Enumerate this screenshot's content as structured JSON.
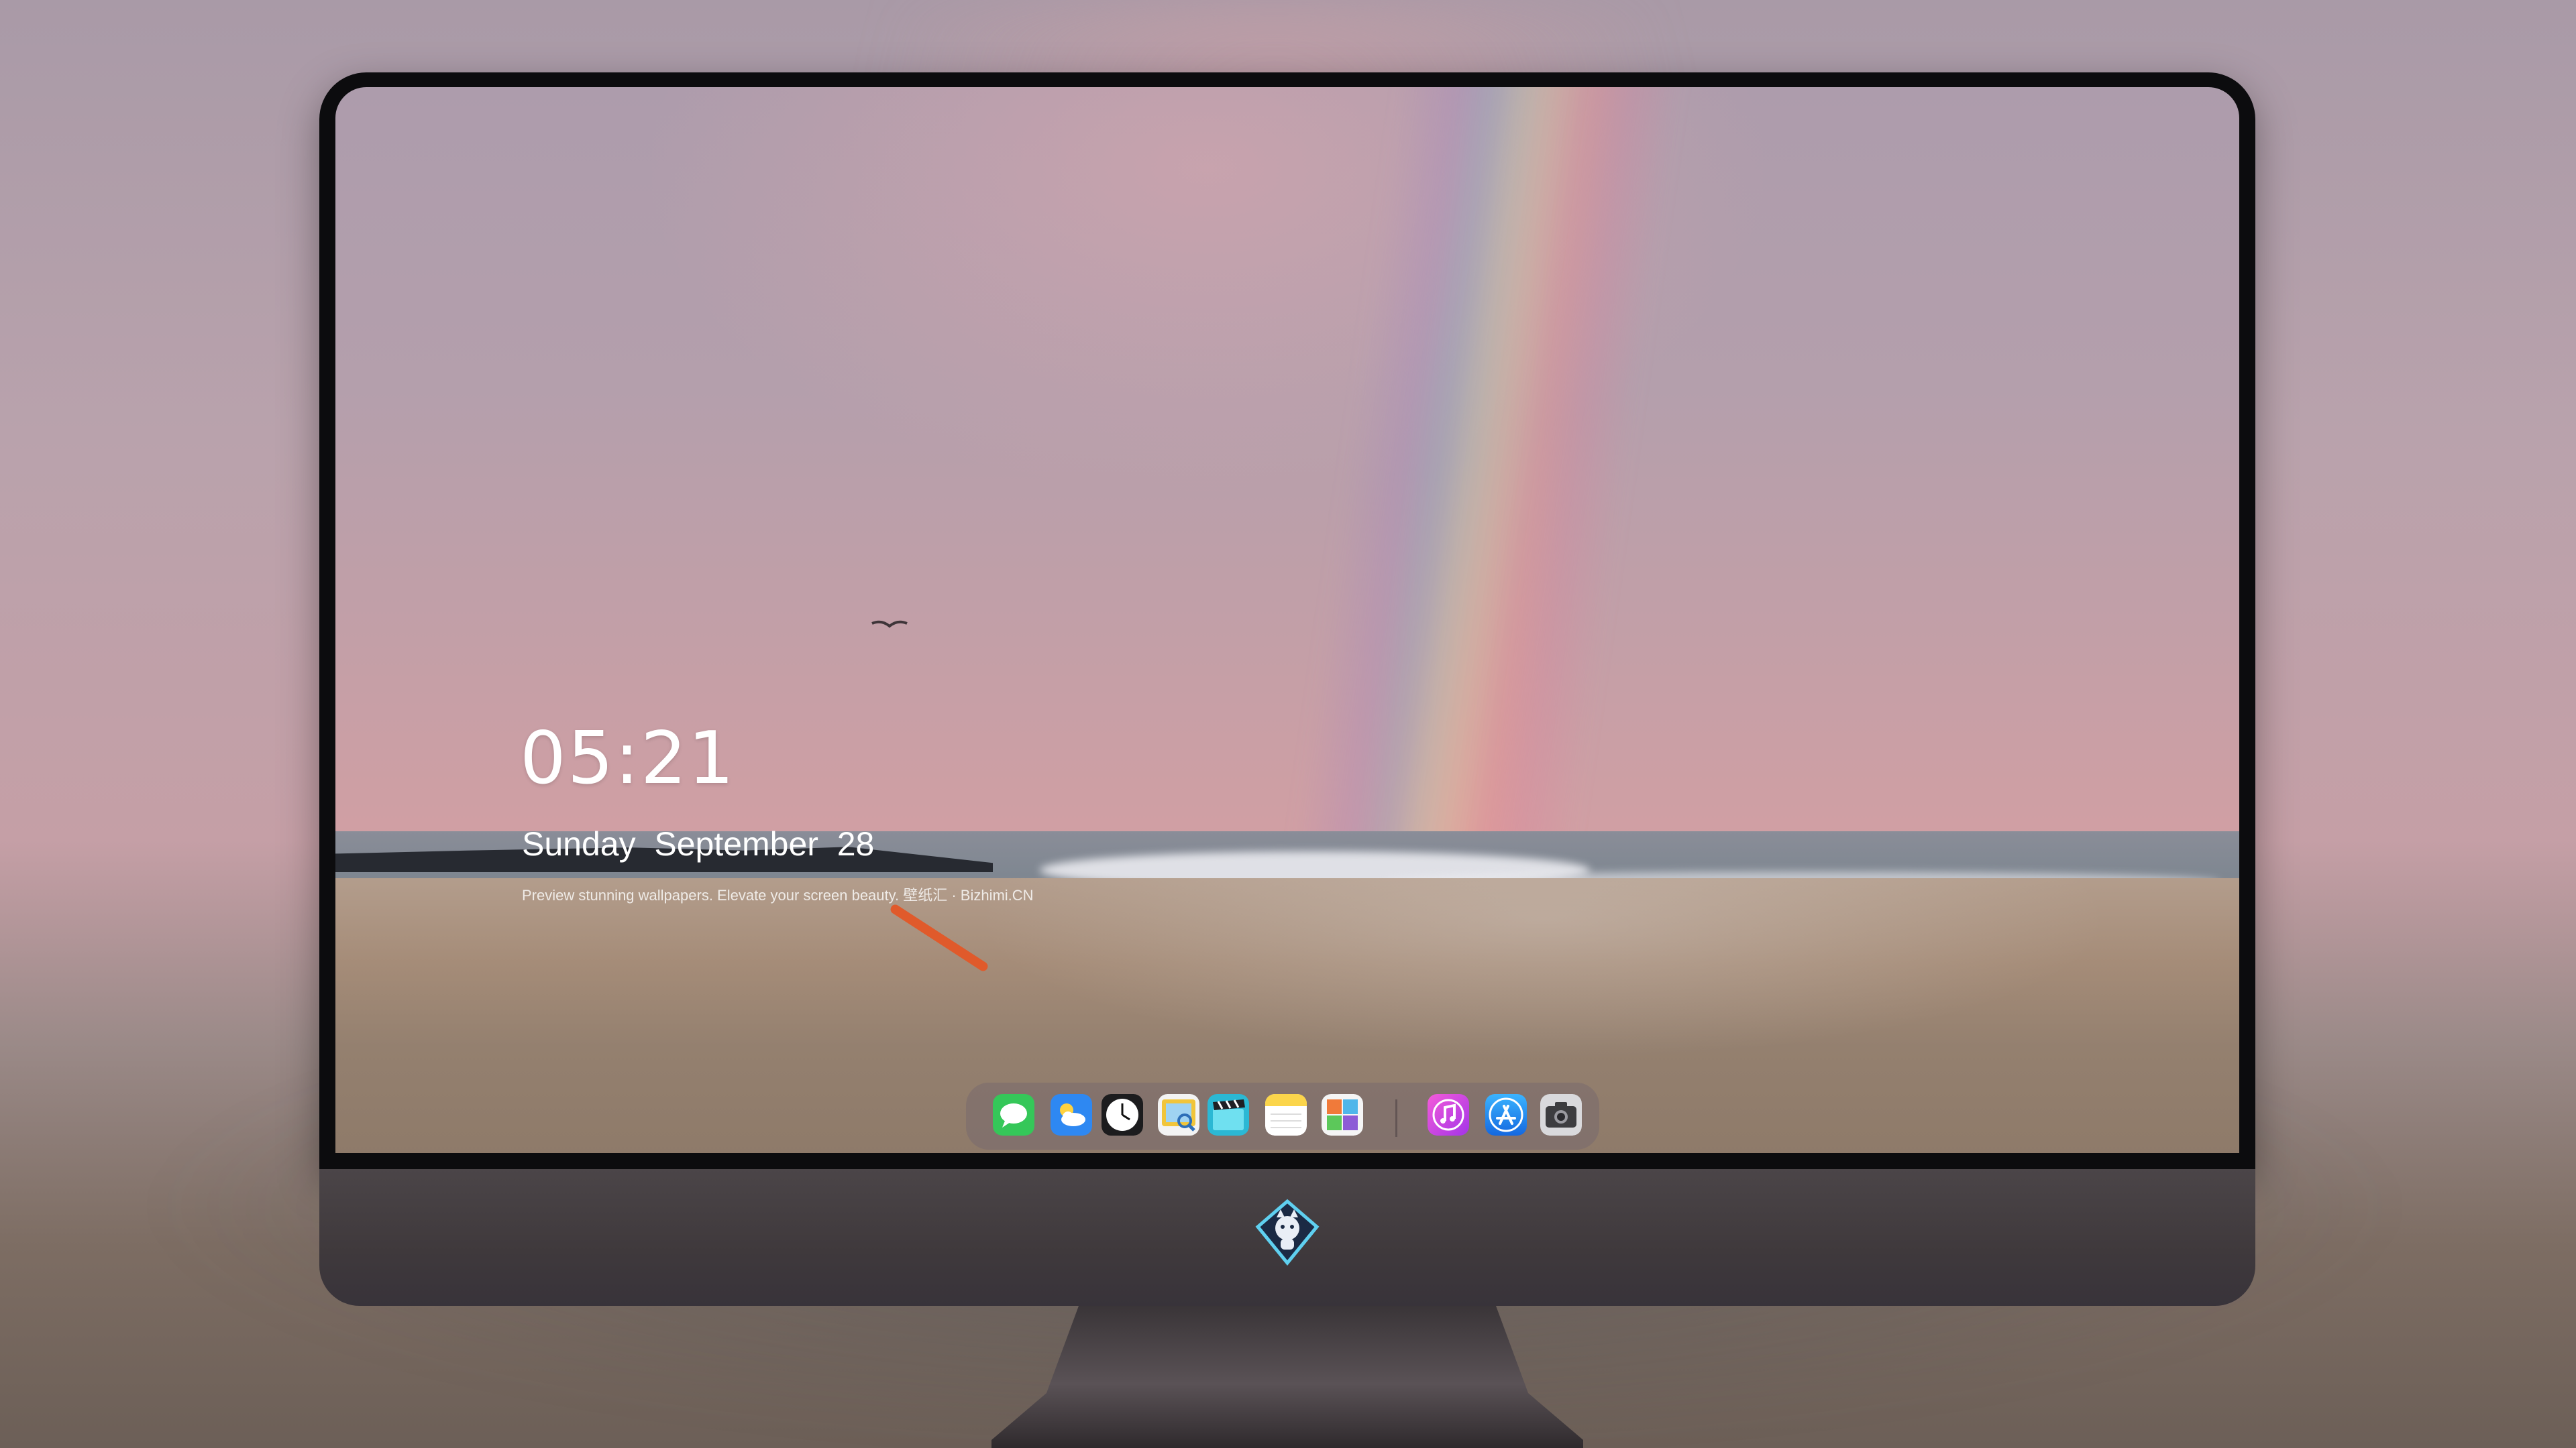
{
  "lock_screen": {
    "time": "05:21",
    "date": "Sunday  September  28",
    "tagline": "Preview stunning wallpapers. Elevate your screen beauty. 壁纸汇 · Bizhimi.CN"
  },
  "dock": {
    "items": [
      {
        "name": "messages-icon",
        "color": "#35c759"
      },
      {
        "name": "weather-icon",
        "color": "#2e88f2"
      },
      {
        "name": "clock-icon",
        "color": "#1c1c1e"
      },
      {
        "name": "preview-icon",
        "color": "#f1c53a"
      },
      {
        "name": "video-clapper-icon",
        "color": "#2bb8d4"
      },
      {
        "name": "notes-icon",
        "color": "#fbd54b"
      },
      {
        "name": "photos-app-icon",
        "color": "#f07a3a"
      },
      {
        "name": "music-icon",
        "color": "#e23ad4"
      },
      {
        "name": "app-store-icon",
        "color": "#1d8bf0"
      },
      {
        "name": "camera-icon",
        "color": "#3d3d40"
      }
    ]
  },
  "colors": {
    "text": "#ffffff",
    "bezel": "#0c0c0e",
    "chin": "#433d40",
    "sky_pink": "#d29fa3",
    "sand": "#a58c78"
  }
}
